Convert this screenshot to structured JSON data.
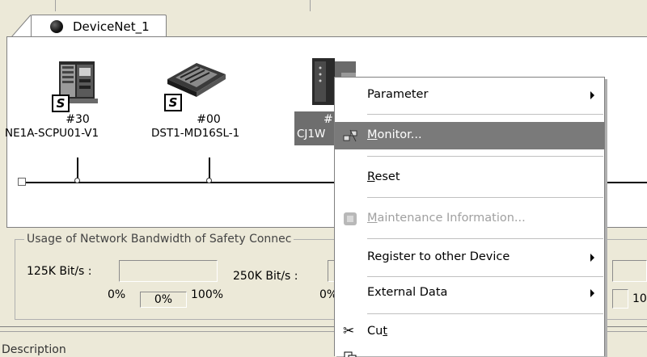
{
  "network_tab": {
    "label": "DeviceNet_1",
    "icon": "globe-icon"
  },
  "devices": [
    {
      "number": "#30",
      "name": "NE1A-SCPU01-V1",
      "icon": "safety-controller-icon",
      "badge": "S"
    },
    {
      "number": "#00",
      "name": "DST1-MD16SL-1",
      "icon": "safety-io-terminal-icon",
      "badge": "S"
    },
    {
      "number": "#",
      "name": "CJ1W",
      "icon": "cj1w-unit-icon"
    }
  ],
  "usage": {
    "title": "Usage of Network Bandwidth of Safety Connec",
    "rate1_label": "125K Bit/s :",
    "rate1_min": "0%",
    "rate1_value": "0%",
    "rate1_max": "100%",
    "rate2_label": "250K Bit/s :",
    "rate2_min": "0%",
    "rate3_max": "10"
  },
  "description": {
    "label": "Description"
  },
  "context_menu": {
    "items": [
      {
        "label": "Parameter",
        "submenu": true
      },
      {
        "label": "Monitor...",
        "mnemonic": "M",
        "rest": "onitor...",
        "highlighted": true,
        "icon": "monitor-icon"
      },
      {
        "label": "Reset",
        "mnemonic": "R",
        "rest": "eset"
      },
      {
        "label": "Maintenance Information...",
        "mnemonic": "M",
        "rest": "aintenance Information...",
        "disabled": true,
        "icon": "maintenance-icon"
      },
      {
        "label": "Register to other Device",
        "submenu": true
      },
      {
        "label": "External Data",
        "submenu": true
      },
      {
        "label": "Cut",
        "pre": "Cu",
        "mnemonic": "t",
        "icon": "scissors-icon"
      }
    ]
  }
}
